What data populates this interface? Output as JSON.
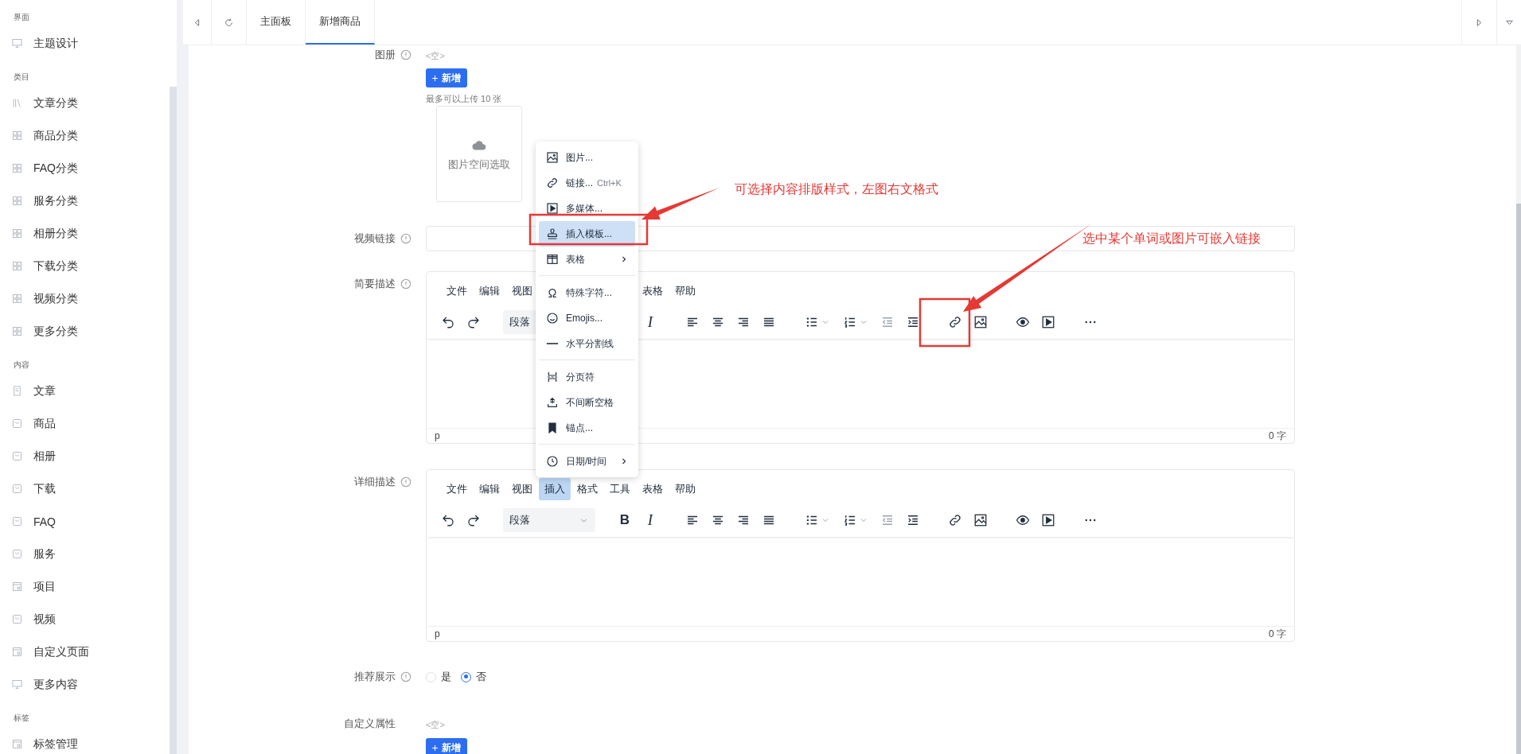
{
  "sidebar": [
    {
      "label": "界面",
      "items": [
        {
          "label": "主题设计",
          "kind": "display"
        }
      ]
    },
    {
      "label": "类目",
      "items": [
        {
          "label": "文章分类",
          "kind": "archive"
        },
        {
          "label": "商品分类",
          "kind": "category"
        },
        {
          "label": "FAQ分类",
          "kind": "category"
        },
        {
          "label": "服务分类",
          "kind": "category"
        },
        {
          "label": "相册分类",
          "kind": "category"
        },
        {
          "label": "下载分类",
          "kind": "category"
        },
        {
          "label": "视频分类",
          "kind": "category"
        },
        {
          "label": "更多分类",
          "kind": "category"
        }
      ]
    },
    {
      "label": "内容",
      "items": [
        {
          "label": "文章",
          "kind": "article"
        },
        {
          "label": "商品",
          "kind": "entry"
        },
        {
          "label": "相册",
          "kind": "entry"
        },
        {
          "label": "下载",
          "kind": "entry"
        },
        {
          "label": "FAQ",
          "kind": "entry"
        },
        {
          "label": "服务",
          "kind": "entry"
        },
        {
          "label": "项目",
          "kind": "module"
        },
        {
          "label": "视频",
          "kind": "entry"
        },
        {
          "label": "自定义页面",
          "kind": "module"
        },
        {
          "label": "更多内容",
          "kind": "display"
        }
      ]
    },
    {
      "label": "标签",
      "items": [
        {
          "label": "标签管理",
          "kind": "module"
        }
      ]
    }
  ],
  "tabs": [
    {
      "label": "主面板",
      "selected": false
    },
    {
      "label": "新增商品",
      "selected": true
    }
  ],
  "form": {
    "album": {
      "label": "图册",
      "value": "<空>",
      "add_button": "新增",
      "hint": "最多可以上传 10 张",
      "upload_label": "图片空间选取"
    },
    "video": {
      "label": "视频链接"
    },
    "editors": [
      {
        "label": "简要描述",
        "menu": [
          {
            "kind": "item",
            "label": "文件",
            "selected": false
          },
          {
            "kind": "item",
            "label": "编辑",
            "selected": false
          },
          {
            "kind": "item",
            "label": "视图",
            "selected": false
          },
          {
            "kind": "covered"
          },
          {
            "kind": "covered"
          },
          {
            "kind": "covered"
          },
          {
            "kind": "item",
            "label": "表格",
            "selected": false
          },
          {
            "kind": "item",
            "label": "帮助",
            "selected": false
          }
        ],
        "format": "段落",
        "italic": "I",
        "path": "p",
        "count": "0 字"
      },
      {
        "label": "详细描述",
        "menu": [
          {
            "kind": "item",
            "label": "文件",
            "selected": false
          },
          {
            "kind": "item",
            "label": "编辑",
            "selected": false
          },
          {
            "kind": "item",
            "label": "视图",
            "selected": false
          },
          {
            "kind": "item",
            "label": "插入",
            "selected": true,
            "dropdown": [
              {
                "label": "图片...",
                "kind": "image",
                "selected": false,
                "submenu": false,
                "separator_before": false
              },
              {
                "label": "链接...",
                "shortcut": "Ctrl+K",
                "kind": "link",
                "selected": false,
                "submenu": false,
                "separator_before": false
              },
              {
                "label": "多媒体...",
                "kind": "media",
                "selected": false,
                "submenu": false,
                "separator_before": false
              },
              {
                "label": "插入模板...",
                "kind": "template",
                "selected": true,
                "submenu": false,
                "separator_before": false
              },
              {
                "label": "表格",
                "kind": "table",
                "selected": false,
                "submenu": true,
                "separator_before": false
              },
              {
                "label": "特殊字符...",
                "kind": "charmap",
                "selected": false,
                "submenu": false,
                "separator_before": true
              },
              {
                "label": "Emojis...",
                "kind": "emoticons",
                "selected": false,
                "submenu": false,
                "separator_before": false
              },
              {
                "label": "水平分割线",
                "kind": "hr",
                "selected": false,
                "submenu": false,
                "separator_before": false
              },
              {
                "label": "分页符",
                "kind": "pagebreak",
                "selected": false,
                "submenu": false,
                "separator_before": true
              },
              {
                "label": "不间断空格",
                "kind": "nonbreaking",
                "selected": false,
                "submenu": false,
                "separator_before": false
              },
              {
                "label": "锚点...",
                "kind": "anchor",
                "selected": false,
                "submenu": false,
                "separator_before": false
              },
              {
                "label": "日期/时间",
                "kind": "datetime",
                "selected": false,
                "submenu": true,
                "separator_before": true
              }
            ]
          },
          {
            "kind": "item",
            "label": "格式",
            "selected": false
          },
          {
            "kind": "item",
            "label": "工具",
            "selected": false
          },
          {
            "kind": "item",
            "label": "表格",
            "selected": false
          },
          {
            "kind": "item",
            "label": "帮助",
            "selected": false
          }
        ],
        "format": "段落",
        "bold": "B",
        "italic": "I",
        "path": "p",
        "count": "0 字"
      }
    ],
    "recommend": {
      "label": "推荐展示",
      "options": [
        {
          "label": "是",
          "selected": false
        },
        {
          "label": "否",
          "selected": true
        }
      ]
    },
    "custom": {
      "label": "自定义属性",
      "value": "<空>",
      "add_button": "新增"
    }
  },
  "annotations": [
    {
      "text": "可选择内容排版样式，左图右文格式"
    },
    {
      "text": "选中某个单词或图片可嵌入链接"
    }
  ]
}
